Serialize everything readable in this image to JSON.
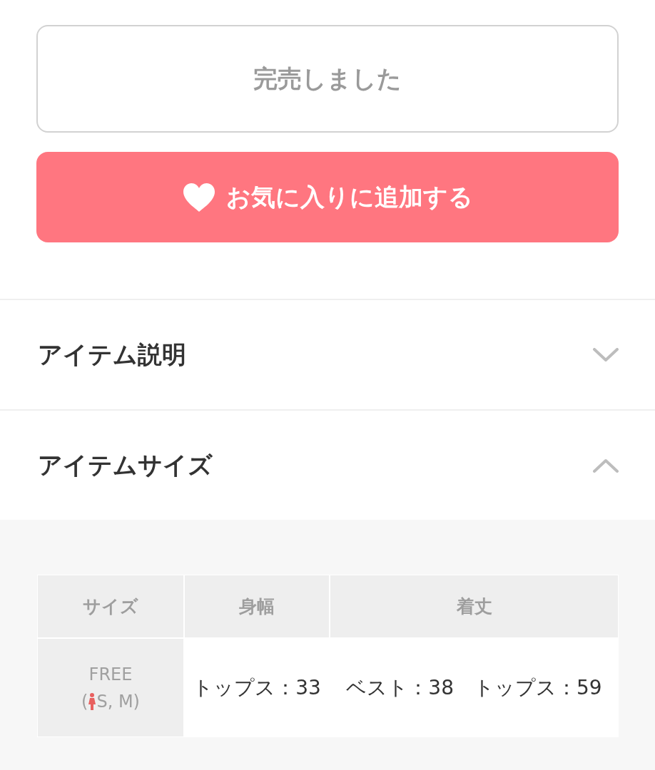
{
  "actions": [
    {
      "kind": "soldout",
      "label": "完売しました",
      "disabled": true
    },
    {
      "kind": "favorite",
      "label": "お気に入りに追加する",
      "disabled": false
    }
  ],
  "sections": [
    {
      "title": "アイテム説明",
      "expanded": false
    },
    {
      "title": "アイテムサイズ",
      "expanded": true,
      "size_table": {
        "columns": [
          "サイズ",
          "身幅",
          "着丈"
        ],
        "rows": [
          {
            "cells": [
              {
                "kind": "size",
                "text": "FREE",
                "fit_open": "(",
                "fit_sizes": "S, M)"
              },
              {
                "kind": "value",
                "text": "トップス：33"
              },
              {
                "kind": "value",
                "text": "ベスト：38　トップス：59"
              }
            ]
          }
        ]
      }
    }
  ]
}
